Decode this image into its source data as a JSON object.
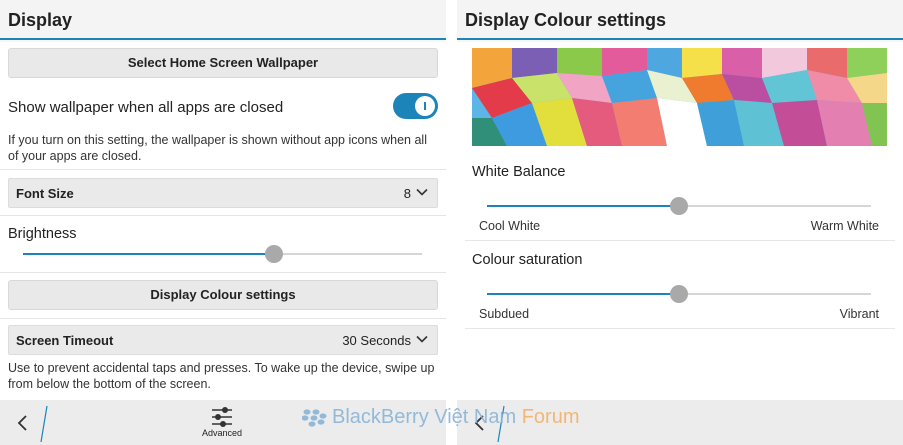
{
  "left_panel": {
    "title": "Display",
    "wallpaper_button": "Select Home Screen Wallpaper",
    "show_wallpaper": {
      "label": "Show wallpaper when all apps are closed",
      "enabled": true,
      "description": "If you turn on this setting, the wallpaper is shown without app icons when all of your apps are closed."
    },
    "font_size": {
      "label": "Font Size",
      "value": "8"
    },
    "brightness": {
      "label": "Brightness",
      "level": 0.63
    },
    "display_colour_button": "Display Colour settings",
    "screen_timeout": {
      "label": "Screen Timeout",
      "value": "30 Seconds",
      "description": "Use to prevent accidental taps and presses. To wake up the device, swipe up from below the bottom of the screen."
    },
    "bottom_bar": {
      "advanced_label": "Advanced"
    }
  },
  "right_panel": {
    "title": "Display Colour settings",
    "white_balance": {
      "label": "White Balance",
      "min_label": "Cool White",
      "max_label": "Warm White",
      "level": 0.5
    },
    "colour_saturation": {
      "label": "Colour saturation",
      "min_label": "Subdued",
      "max_label": "Vibrant",
      "level": 0.5
    }
  },
  "watermark": {
    "brand": "BlackBerry Việt Nam",
    "suffix": "Forum"
  },
  "colors": {
    "accent": "#1c84b8",
    "knob": "#a9a9a9",
    "track": "#d6d6d6"
  }
}
